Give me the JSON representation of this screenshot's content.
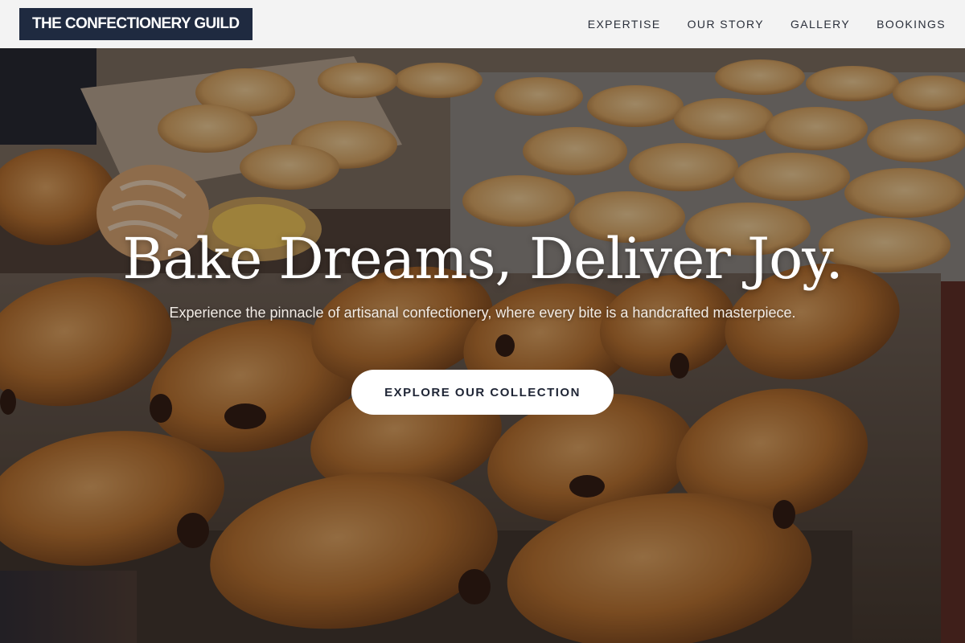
{
  "header": {
    "brand": "THE CONFECTIONERY GUILD",
    "nav": [
      {
        "label": "EXPERTISE"
      },
      {
        "label": "OUR STORY"
      },
      {
        "label": "GALLERY"
      },
      {
        "label": "BOOKINGS"
      }
    ]
  },
  "hero": {
    "title": "Bake Dreams, Deliver Joy.",
    "subtitle": "Experience the pinnacle of artisanal confectionery, where every bite is a handcrafted masterpiece.",
    "cta_label": "EXPLORE OUR COLLECTION",
    "background_image": "pastry-tray-photo"
  },
  "colors": {
    "header_bg": "#f3f3f3",
    "brand_bg": "#1f2a40",
    "brand_text": "#ffffff",
    "nav_text": "#2a2f3a",
    "hero_text": "#ffffff",
    "cta_bg": "#ffffff",
    "cta_text": "#1f2535"
  }
}
